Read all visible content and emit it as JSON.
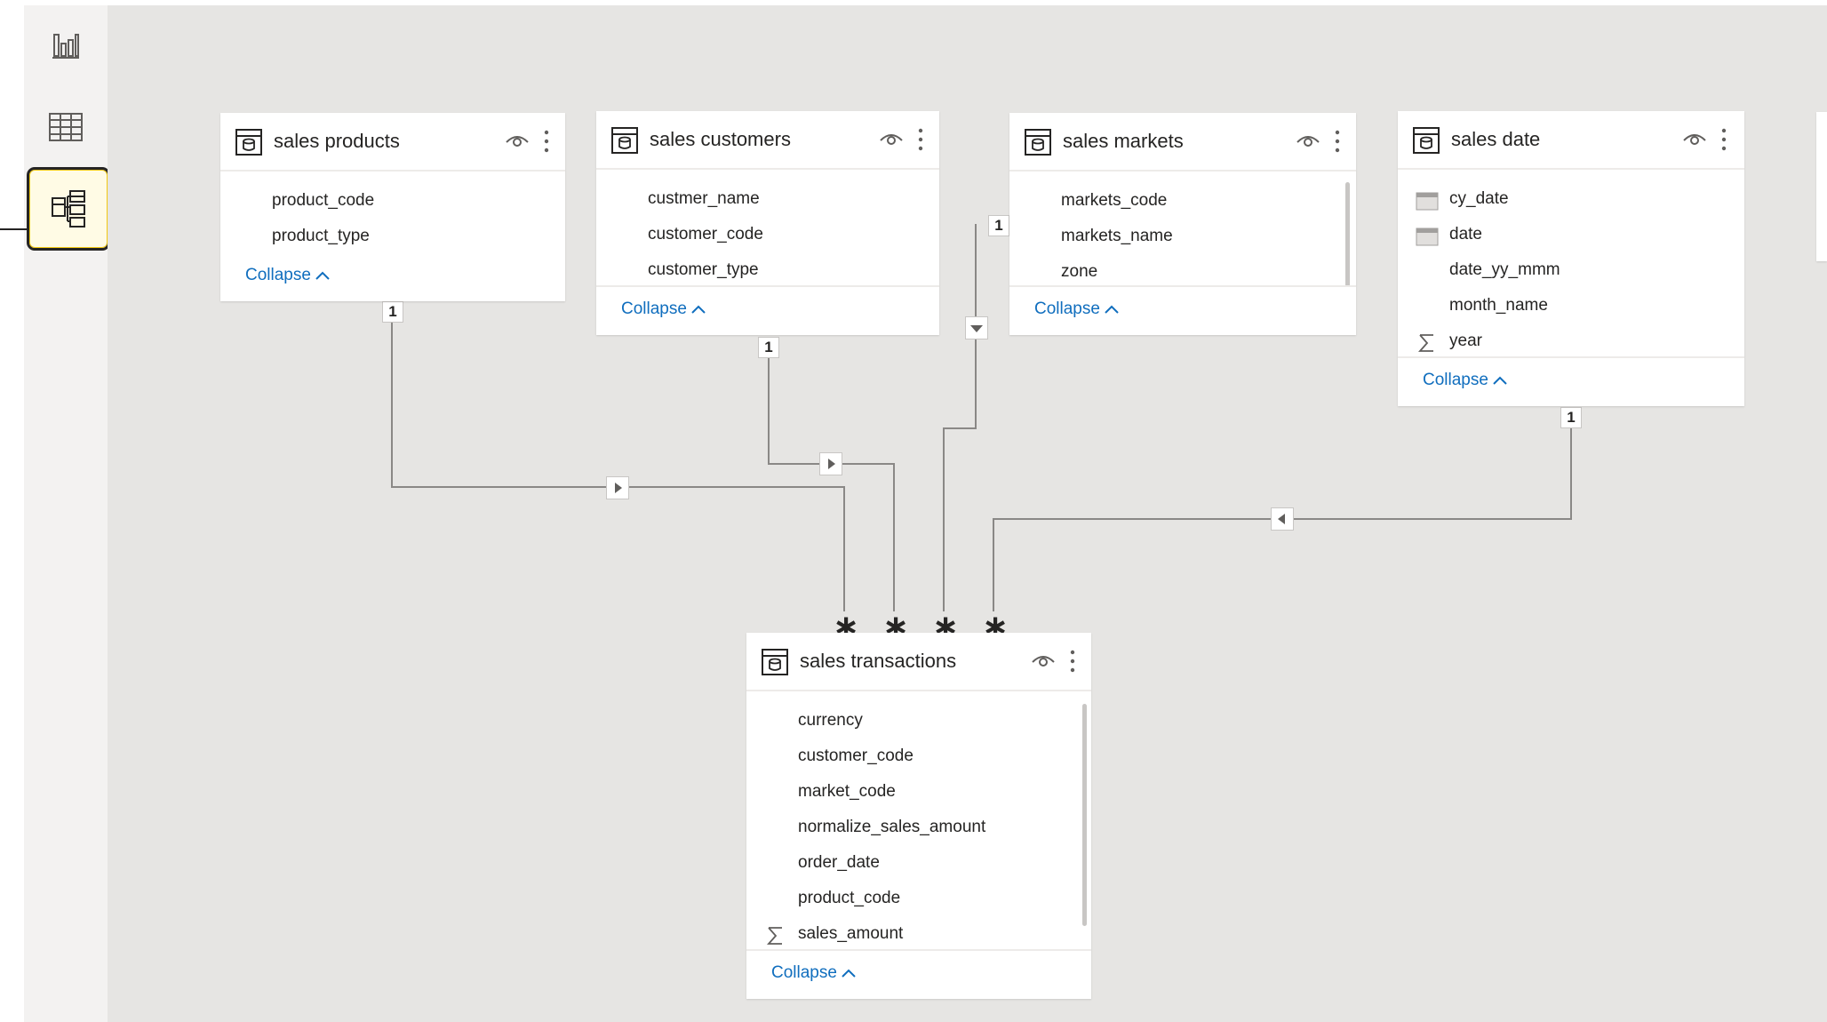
{
  "rail": {
    "items": [
      {
        "name": "report-view",
        "icon": "bar-chart-icon"
      },
      {
        "name": "data-view",
        "icon": "table-grid-icon"
      },
      {
        "name": "model-view",
        "icon": "model-icon",
        "active": true
      }
    ]
  },
  "tables": {
    "products": {
      "title": "sales products",
      "fields": [
        "product_code",
        "product_type"
      ],
      "collapse": "Collapse"
    },
    "customers": {
      "title": "sales customers",
      "fields": [
        "custmer_name",
        "customer_code",
        "customer_type"
      ],
      "collapse": "Collapse"
    },
    "markets": {
      "title": "sales markets",
      "fields": [
        "markets_code",
        "markets_name",
        "zone"
      ],
      "collapse": "Collapse"
    },
    "date": {
      "title": "sales date",
      "fields": [
        {
          "name": "cy_date",
          "icon": "calendar-icon"
        },
        {
          "name": "date",
          "icon": "calendar-icon"
        },
        {
          "name": "date_yy_mmm",
          "icon": ""
        },
        {
          "name": "month_name",
          "icon": ""
        },
        {
          "name": "year",
          "icon": "sigma-icon"
        }
      ],
      "collapse": "Collapse"
    },
    "transactions": {
      "title": "sales transactions",
      "fields": [
        {
          "name": "currency",
          "icon": ""
        },
        {
          "name": "customer_code",
          "icon": ""
        },
        {
          "name": "market_code",
          "icon": ""
        },
        {
          "name": "normalize_sales_amount",
          "icon": ""
        },
        {
          "name": "order_date",
          "icon": ""
        },
        {
          "name": "product_code",
          "icon": ""
        },
        {
          "name": "sales_amount",
          "icon": "sigma-icon"
        }
      ],
      "collapse": "Collapse"
    }
  },
  "relationships": {
    "one_label": "1",
    "many_label": "∗"
  },
  "colors": {
    "canvas": "#e6e5e3",
    "rail": "#f3f2f1",
    "link": "#106ebe",
    "line": "#8a8886",
    "active_border": "#252423"
  }
}
